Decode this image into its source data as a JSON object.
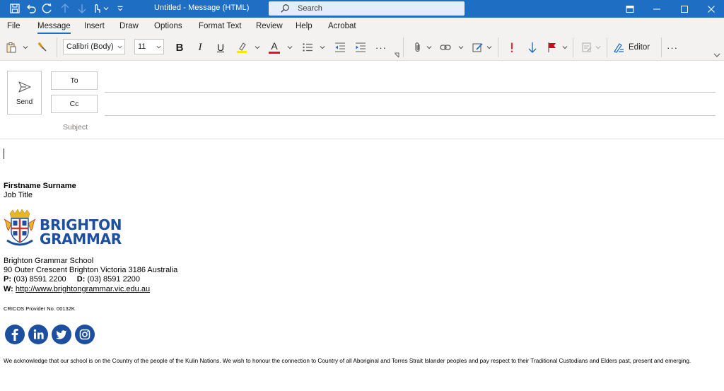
{
  "titlebar": {
    "title": "Untitled  -  Message (HTML)",
    "search_placeholder": "Search",
    "icons": [
      "save-icon",
      "undo-icon",
      "redo-icon",
      "up-arrow-icon",
      "down-arrow-icon",
      "touch-mode-icon",
      "customize-icon"
    ]
  },
  "tabs": [
    {
      "label": "File"
    },
    {
      "label": "Message",
      "active": true
    },
    {
      "label": "Insert"
    },
    {
      "label": "Draw"
    },
    {
      "label": "Options"
    },
    {
      "label": "Format Text"
    },
    {
      "label": "Review"
    },
    {
      "label": "Help"
    },
    {
      "label": "Acrobat"
    }
  ],
  "ribbon": {
    "font_name": "Calibri (Body)",
    "font_size": "11",
    "bold": "B",
    "italic": "I",
    "underline": "U",
    "font_color_glyph": "A",
    "more": "···",
    "editor_label": "Editor",
    "overflow": "···"
  },
  "compose": {
    "send_label": "Send",
    "to_label": "To",
    "cc_label": "Cc",
    "subject_label": "Subject",
    "to_value": "",
    "cc_value": "",
    "subject_value": ""
  },
  "signature": {
    "name": "Firstname Surname",
    "job_title": "Job Title",
    "logo_line1": "BRIGHTON",
    "logo_line2": "GRAMMAR",
    "org": "Brighton Grammar School",
    "address": "90 Outer Crescent Brighton Victoria 3186 Australia",
    "phone_label": "P:",
    "phone": "(03) 8591 2200",
    "direct_label": "D:",
    "direct": "(03) 8591 2200",
    "web_label": "W:",
    "web": "http://www.brightongrammar.vic.edu.au",
    "cricos": "CRICOS Provider No.  00132K",
    "social": [
      "facebook-icon",
      "linkedin-icon",
      "twitter-icon",
      "instagram-icon"
    ],
    "acknowledgement": "We acknowledge that our school is on the Country of the people of the Kulin Nations. We wish to honour the connection to Country of all Aboriginal and Torres Strait Islander peoples and pay respect to their Traditional Custodians and Elders past, present and emerging."
  },
  "colors": {
    "titlebar": "#1e6ec3",
    "brand": "#1c4fa0",
    "ribbon_bg": "#f3f2f1",
    "importance_red": "#d13438",
    "flag_red": "#c50f1f"
  }
}
